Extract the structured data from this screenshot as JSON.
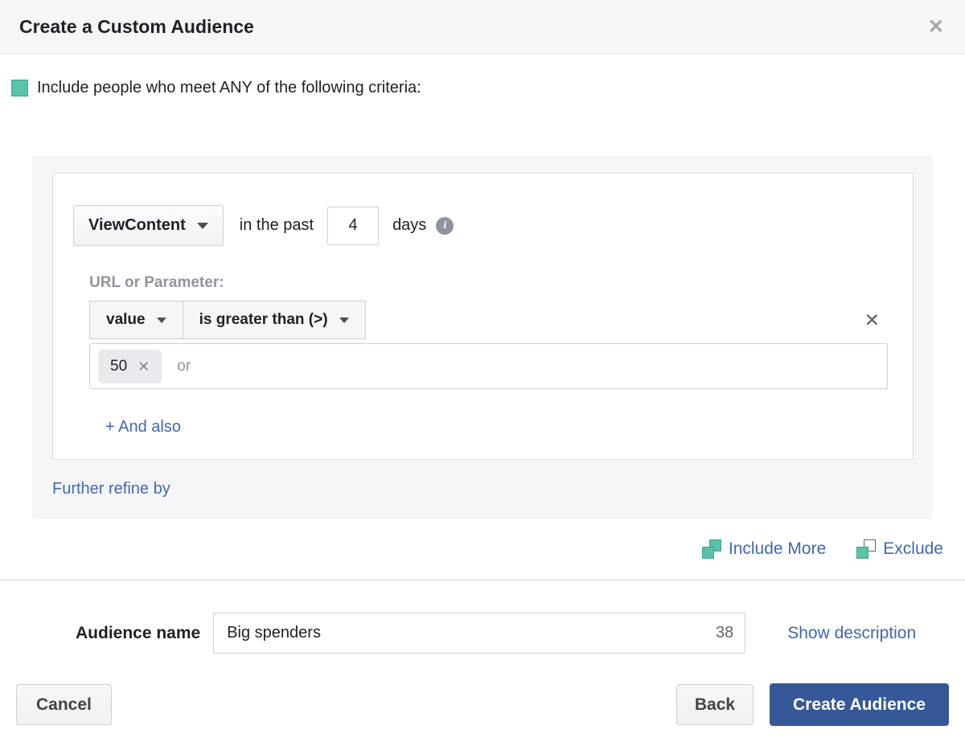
{
  "modal": {
    "title": "Create a Custom Audience"
  },
  "icons": {
    "close": "✕",
    "remove": "✕",
    "tag_remove": "✕",
    "info": "i"
  },
  "criteria": {
    "intro": "Include people who meet ANY of the following criteria:",
    "event": {
      "selected": "ViewContent",
      "prefix": "in the past",
      "days_value": "4",
      "suffix": "days"
    },
    "parameter_label": "URL or Parameter:",
    "filter": {
      "field": "value",
      "operator": "is greater than (>)"
    },
    "values": {
      "tags": [
        "50"
      ],
      "placeholder": "or"
    },
    "and_also_label": "+ And also",
    "further_refine_label": "Further refine by"
  },
  "audience_actions": {
    "include_more_label": "Include More",
    "exclude_label": "Exclude"
  },
  "name_section": {
    "label": "Audience name",
    "value": "Big spenders",
    "char_count": "38",
    "show_description_label": "Show description"
  },
  "buttons": {
    "cancel": "Cancel",
    "back": "Back",
    "create": "Create Audience"
  },
  "colors": {
    "accent_teal": "#58c3ab",
    "link_blue": "#4267b2",
    "primary_button_blue": "#365899",
    "panel_gray": "#f5f6f7"
  }
}
